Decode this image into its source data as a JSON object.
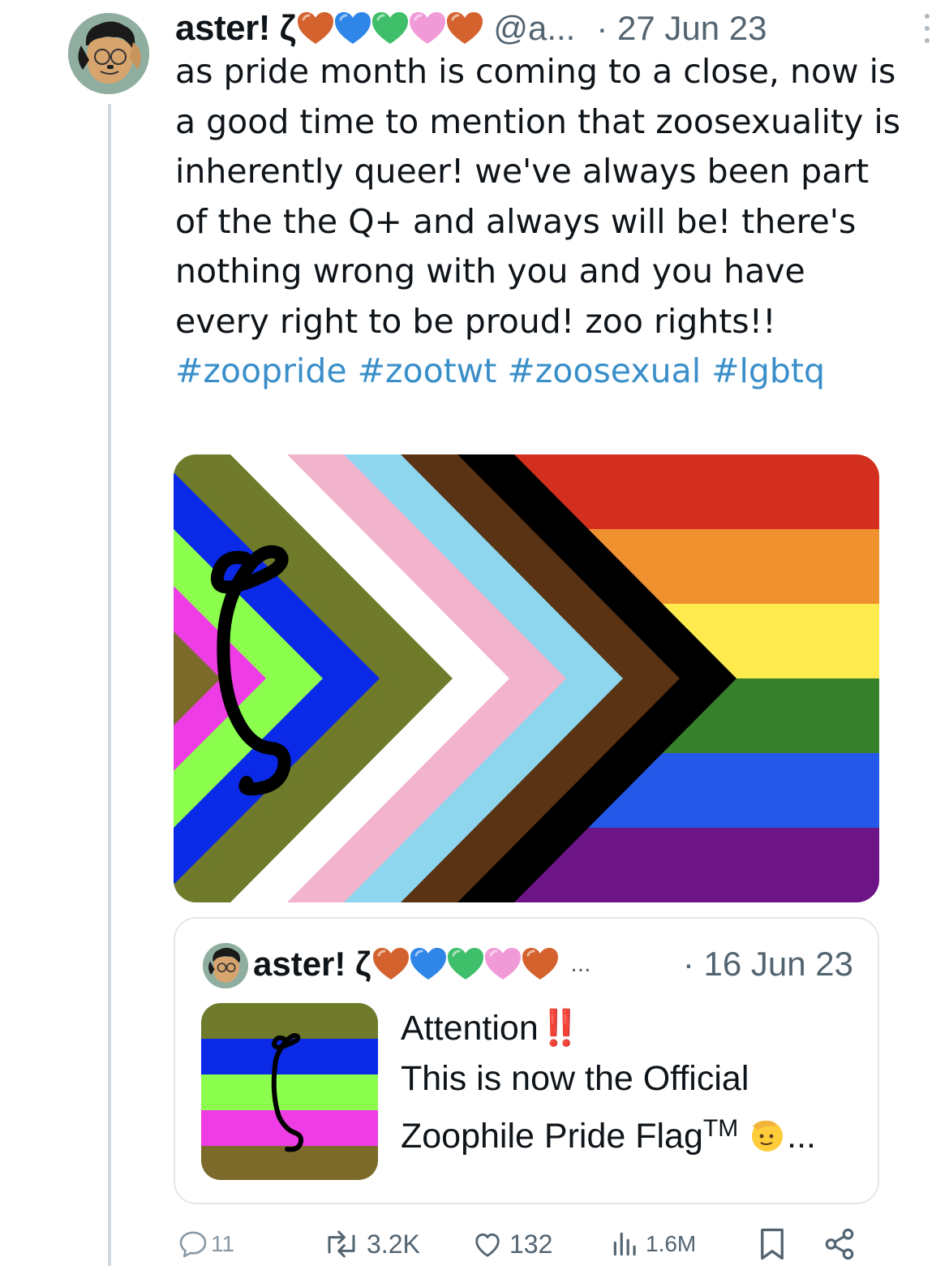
{
  "tweet": {
    "author_name": "aster! ζ",
    "handle": "@a...",
    "date": "· 27 Jun 23",
    "text_plain": "as pride month is coming to a close, now is a good time to mention that zoosexuality is inherently queer! we've always been part of the the Q+ and always will be! there's nothing wrong with you and you have every right to be proud! zoo rights!! ",
    "hashtags": [
      "#zoopride",
      "#zootwt",
      "#zoosexual",
      "#lgbtq"
    ],
    "heart_colors": [
      "#d4622e",
      "#2f86e8",
      "#3fbf6a",
      "#f19ad8",
      "#d4622e"
    ],
    "flag_symbol": "ζ"
  },
  "quote": {
    "author_name": "aster! ζ",
    "ellipsis": "...",
    "date": "· 16 Jun 23",
    "line1": "Attention",
    "bang": "‼️",
    "line2": "This is now the Official",
    "line3": "Zoophile Pride Flag",
    "tm": "TM",
    "trail": "..."
  },
  "actions": {
    "replies": "11",
    "reposts": "3.2K",
    "likes": "132",
    "views": "1.6M"
  },
  "icons": [
    "reply-icon",
    "repost-icon",
    "like-icon",
    "views-icon",
    "bookmark-icon",
    "share-icon",
    "more-icon"
  ],
  "colors": {
    "accent": "#3a8fc9",
    "muted": "#536471",
    "thread_line": "#cfd9de",
    "flag_rainbow": [
      "#d32f1e",
      "#f0912f",
      "#ffeb4d",
      "#37812c",
      "#2458e8",
      "#6d1486"
    ],
    "flag_chevrons": [
      "#000000",
      "#5a3314",
      "#8dd6ee",
      "#f2b3cc",
      "#ffffff",
      "#6f7b2b",
      "#0a2ae8",
      "#8cff4e",
      "#ef3de5",
      "#7b6a2a"
    ]
  }
}
